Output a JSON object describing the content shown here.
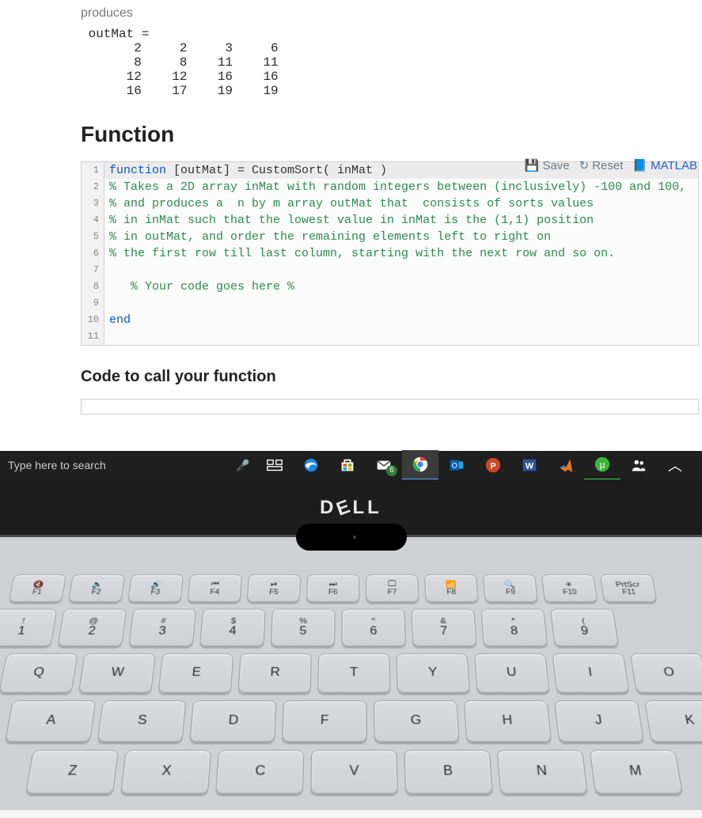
{
  "page": {
    "produces": "produces",
    "outmat_label": "outMat =",
    "outmat_rows": [
      [
        2,
        2,
        3,
        6
      ],
      [
        8,
        8,
        11,
        11
      ],
      [
        12,
        12,
        16,
        16
      ],
      [
        16,
        17,
        19,
        19
      ]
    ],
    "function_heading": "Function",
    "call_heading": "Code to call your function"
  },
  "toolbar": {
    "save": "Save",
    "reset": "Reset",
    "matlab": "MATLAB"
  },
  "code": {
    "lines": [
      {
        "n": 1,
        "kind": "kw",
        "pre": "function ",
        "plain": "[outMat] = CustomSort( inMat )",
        "hl": true
      },
      {
        "n": 2,
        "kind": "cmt",
        "text": "% Takes a 2D array inMat with random integers between (inclusively) -100 and 100,"
      },
      {
        "n": 3,
        "kind": "cmt",
        "text": "% and produces a  n by m array outMat that  consists of sorts values"
      },
      {
        "n": 4,
        "kind": "cmt",
        "text": "% in inMat such that the lowest value in inMat is the (1,1) position"
      },
      {
        "n": 5,
        "kind": "cmt",
        "text": "% in outMat, and order the remaining elements left to right on"
      },
      {
        "n": 6,
        "kind": "cmt",
        "text": "% the first row till last column, starting with the next row and so on."
      },
      {
        "n": 7,
        "kind": "plain",
        "text": ""
      },
      {
        "n": 8,
        "kind": "cmt",
        "text": "   % Your code goes here %"
      },
      {
        "n": 9,
        "kind": "plain",
        "text": ""
      },
      {
        "n": 10,
        "kind": "kw",
        "text": "end"
      },
      {
        "n": 11,
        "kind": "plain",
        "text": ""
      }
    ]
  },
  "taskbar": {
    "search_placeholder": "Type here to search",
    "mail_badge": "6",
    "icons": [
      "task-view",
      "edge",
      "store",
      "mail",
      "chrome",
      "outlook",
      "powerpoint",
      "word",
      "matlab",
      "utorrent",
      "people",
      "chevron"
    ]
  },
  "laptop": {
    "brand": "DELL",
    "frow": [
      {
        "sym": "🔇",
        "lbl": "F1"
      },
      {
        "sym": "🔉",
        "lbl": "F2"
      },
      {
        "sym": "🔊",
        "lbl": "F3"
      },
      {
        "sym": "⏮",
        "lbl": "F4"
      },
      {
        "sym": "⏯",
        "lbl": "F5"
      },
      {
        "sym": "⏭",
        "lbl": "F6"
      },
      {
        "sym": "🖵",
        "lbl": "F7"
      },
      {
        "sym": "📶",
        "lbl": "F8"
      },
      {
        "sym": "🔍",
        "lbl": "F9"
      },
      {
        "sym": "☀",
        "lbl": "F10"
      },
      {
        "sym": "PrtScr",
        "lbl": "F11"
      }
    ],
    "numrow": [
      {
        "t": "!",
        "b": "1"
      },
      {
        "t": "@",
        "b": "2"
      },
      {
        "t": "#",
        "b": "3"
      },
      {
        "t": "$",
        "b": "4"
      },
      {
        "t": "%",
        "b": "5"
      },
      {
        "t": "^",
        "b": "6"
      },
      {
        "t": "&",
        "b": "7"
      },
      {
        "t": "*",
        "b": "8"
      },
      {
        "t": "(",
        "b": "9"
      }
    ],
    "row_q": [
      "Q",
      "W",
      "E",
      "R",
      "T",
      "Y",
      "U",
      "I",
      "O"
    ],
    "row_a": [
      "A",
      "S",
      "D",
      "F",
      "G",
      "H",
      "J",
      "K"
    ],
    "row_z": [
      "Z",
      "X",
      "C",
      "V",
      "B",
      "N",
      "M"
    ]
  }
}
